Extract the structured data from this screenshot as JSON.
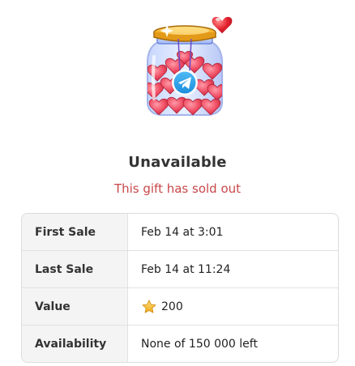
{
  "gift": {
    "status_title": "Unavailable",
    "status_message": "This gift has sold out",
    "icon": "heart-jar-telegram-icon"
  },
  "details": {
    "rows": [
      {
        "label": "First Sale",
        "value": "Feb 14 at 3:01"
      },
      {
        "label": "Last Sale",
        "value": "Feb 14 at 11:24"
      },
      {
        "label": "Value",
        "value": "200",
        "icon": "star-icon"
      },
      {
        "label": "Availability",
        "value": "None of 150 000 left"
      }
    ]
  },
  "colors": {
    "title": "#333333",
    "sold_out": "#c9484a",
    "label_background": "#f4f4f4",
    "border": "#dcdcdc",
    "star": "#f4c542"
  }
}
